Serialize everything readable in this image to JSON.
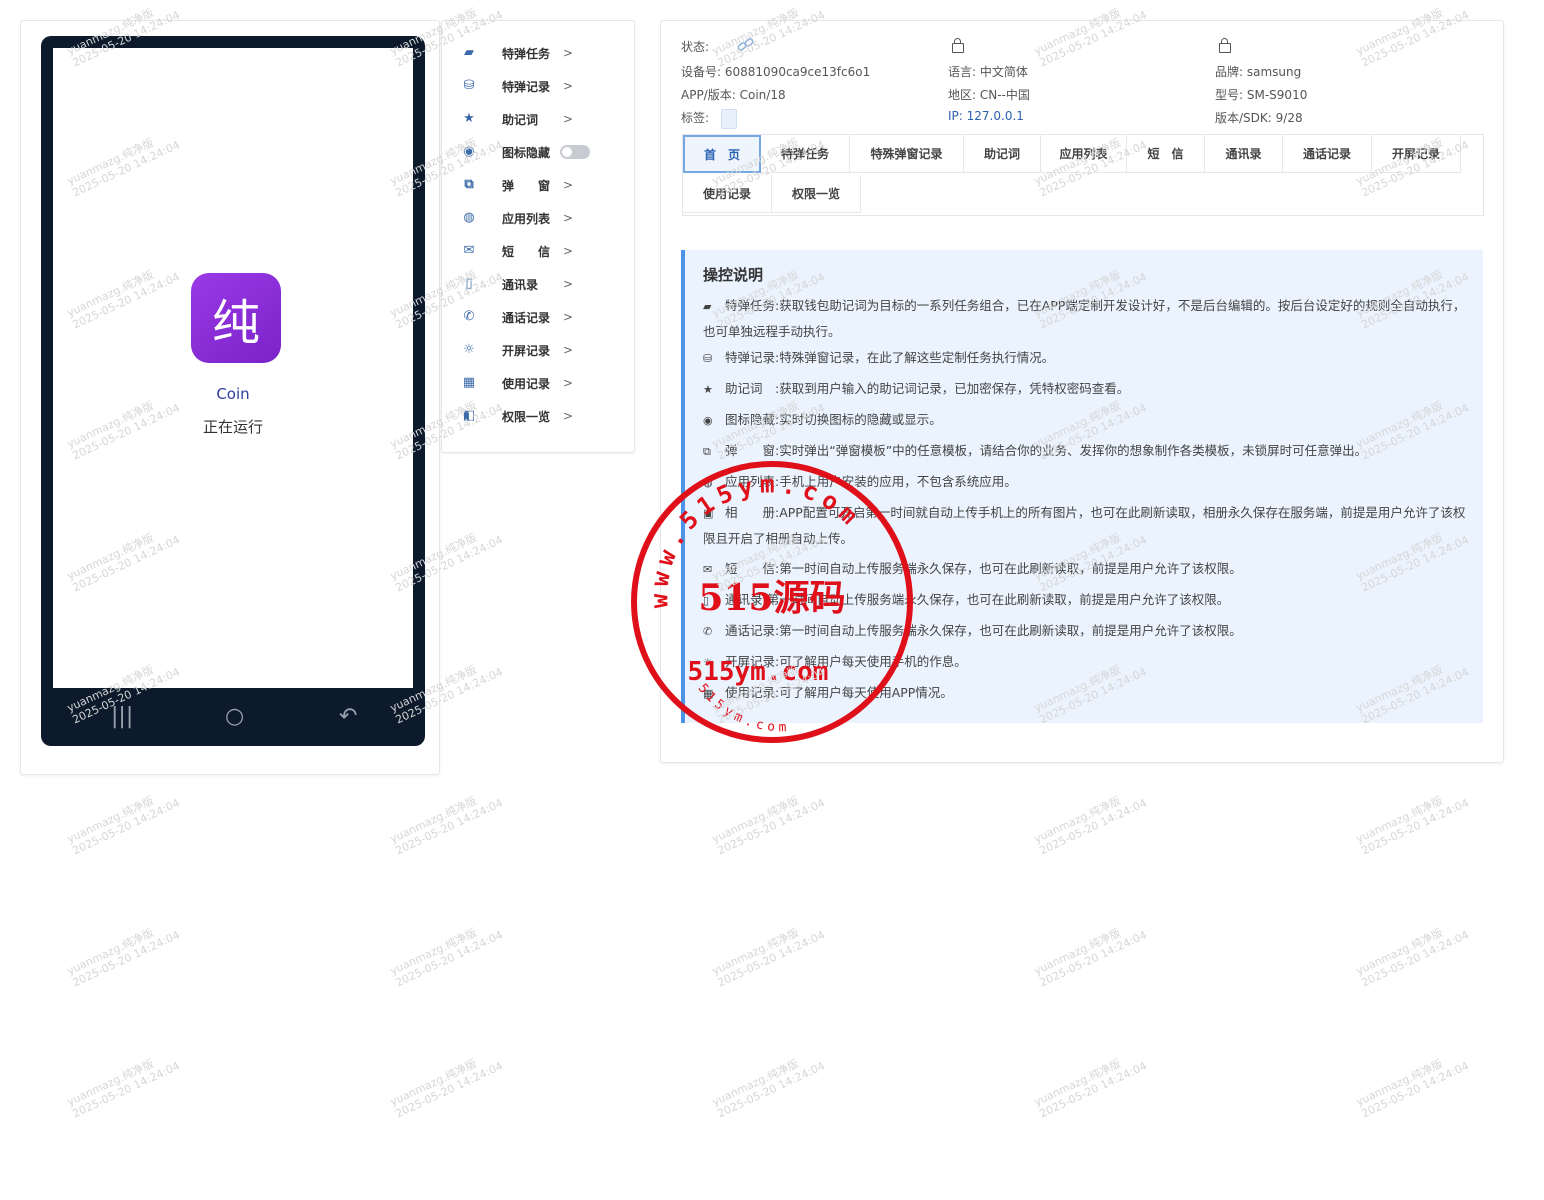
{
  "phone": {
    "app_icon_char": "纯",
    "app_name": "Coin",
    "app_status": "正在运行",
    "nav_keys": [
      "|||",
      "○",
      "↶"
    ]
  },
  "menu": {
    "items": [
      {
        "icon": "wallet-icon",
        "glyph": "▰",
        "label": "特弹任务",
        "arrow": ">"
      },
      {
        "icon": "database-icon",
        "glyph": "⛁",
        "label": "特弹记录",
        "arrow": ">"
      },
      {
        "icon": "star-icon",
        "glyph": "★",
        "label": "助记词",
        "arrow": ">"
      },
      {
        "icon": "eye-icon",
        "glyph": "◉",
        "label": "图标隐藏",
        "toggle": false
      },
      {
        "icon": "copy-icon",
        "glyph": "⧉",
        "label": "弹　　窗",
        "arrow": ">"
      },
      {
        "icon": "chrome-icon",
        "glyph": "◍",
        "label": "应用列表",
        "arrow": ">"
      },
      {
        "icon": "mail-icon",
        "glyph": "✉",
        "label": "短　　信",
        "arrow": ">"
      },
      {
        "icon": "contacts-icon",
        "glyph": "▯",
        "label": "通讯录",
        "arrow": ">"
      },
      {
        "icon": "phone-call-icon",
        "glyph": "✆",
        "label": "通话记录",
        "arrow": ">"
      },
      {
        "icon": "sunrise-icon",
        "glyph": "☼",
        "label": "开屏记录",
        "arrow": ">"
      },
      {
        "icon": "grid-icon",
        "glyph": "▦",
        "label": "使用记录",
        "arrow": ">"
      },
      {
        "icon": "switch-icon",
        "glyph": "◧",
        "label": "权限一览",
        "arrow": ">"
      }
    ]
  },
  "device": {
    "status_label": "状态:",
    "device_id_label": "设备号:",
    "device_id": "60881090ca9ce13fc6o1",
    "app_version_label": "APP/版本:",
    "app_version": "Coin/18",
    "tag_label": "标签:",
    "language_label": "语言:",
    "language": "中文简体",
    "region_label": "地区:",
    "region": "CN--中国",
    "ip_label": "IP:",
    "ip": "127.0.0.1",
    "brand_label": "品牌:",
    "brand": "samsung",
    "model_label": "型号:",
    "model": "SM-S9010",
    "sdk_label": "版本/SDK:",
    "sdk": "9/28"
  },
  "tabs": [
    "首　页",
    "特弹任务",
    "特殊弹窗记录",
    "助记词",
    "应用列表",
    "短　信",
    "通讯录",
    "通话记录",
    "开屏记录",
    "使用记录",
    "权限一览"
  ],
  "active_tab": "首　页",
  "help": {
    "title": "操控说明",
    "lines": [
      {
        "icon": "wallet-icon",
        "glyph": "▰",
        "key": "特弹任务:",
        "text": "获取钱包助记词为目标的一系列任务组合，已在APP端定制开发设计好，不是后台编辑的。按后台设定好的规则全自动执行，也可单独远程手动执行。"
      },
      {
        "icon": "database-icon",
        "glyph": "⛁",
        "key": "特弹记录:",
        "text": "特殊弹窗记录，在此了解这些定制任务执行情况。"
      },
      {
        "icon": "star-icon",
        "glyph": "★",
        "key": "助记词　:",
        "text": "获取到用户输入的助记词记录，已加密保存，凭特权密码查看。"
      },
      {
        "icon": "eye-icon",
        "glyph": "◉",
        "key": "图标隐藏:",
        "text": "实时切换图标的隐藏或显示。"
      },
      {
        "icon": "copy-icon",
        "glyph": "⧉",
        "key": "弹　　窗:",
        "text": "实时弹出“弹窗模板”中的任意模板，请结合你的业务、发挥你的想象制作各类模板，未锁屏时可任意弹出。"
      },
      {
        "icon": "chrome-icon",
        "glyph": "◍",
        "key": "应用列表:",
        "text": "手机上用户安装的应用，不包含系统应用。"
      },
      {
        "icon": "image-icon",
        "glyph": "▣",
        "key": "相　　册:",
        "text": "APP配置可开启第一时间就自动上传手机上的所有图片，也可在此刷新读取，相册永久保存在服务端，前提是用户允许了该权限且开启了相册自动上传。"
      },
      {
        "icon": "mail-icon",
        "glyph": "✉",
        "key": "短　　信:",
        "text": "第一时间自动上传服务端永久保存，也可在此刷新读取，前提是用户允许了该权限。"
      },
      {
        "icon": "contacts-icon",
        "glyph": "▯",
        "key": "通讯录:",
        "text": "第一时间自动上传服务端永久保存，也可在此刷新读取，前提是用户允许了该权限。"
      },
      {
        "icon": "phone-call-icon",
        "glyph": "✆",
        "key": "通话记录:",
        "text": "第一时间自动上传服务端永久保存，也可在此刷新读取，前提是用户允许了该权限。"
      },
      {
        "icon": "sunrise-icon",
        "glyph": "☼",
        "key": "开屏记录:",
        "text": "可了解用户每天使用手机的作息。"
      },
      {
        "icon": "grid-icon",
        "glyph": "▦",
        "key": "使用记录:",
        "text": "可了解用户每天使用APP情况。"
      }
    ]
  },
  "watermark": {
    "line1": "yuanmazg.纯净版",
    "line2": "2025-05-20 14:24:04"
  },
  "stamp": {
    "top_text": "www.515ym.com",
    "center_text": "515源码",
    "bottom_big": "515ym.com",
    "bottom_small": "515ym.com",
    "color": "#e0101a"
  }
}
